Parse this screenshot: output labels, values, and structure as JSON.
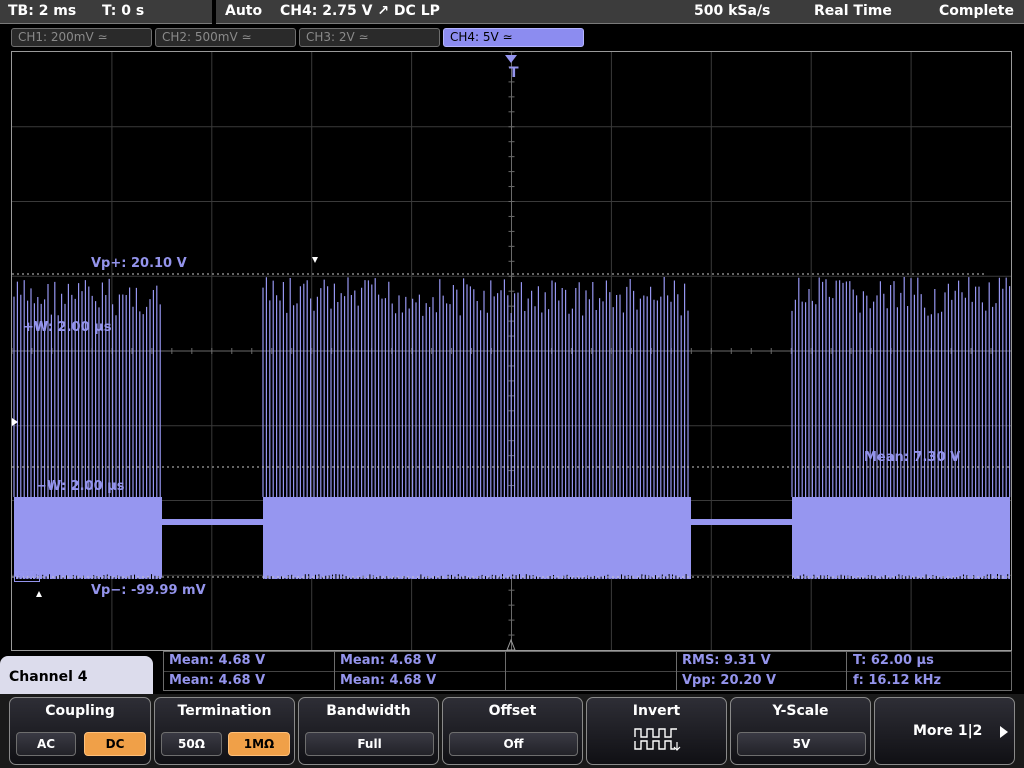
{
  "topbar": {
    "timebase": "TB: 2 ms",
    "trigger_time": "T: 0 s",
    "mode": "Auto",
    "trigger": "CH4: 2.75 V ↗ DC LP",
    "sample_rate": "500 kSa/s",
    "acq_mode": "Real Time",
    "status": "Complete"
  },
  "channel_tabs": [
    {
      "label": "CH1: 200mV ≃",
      "active": false
    },
    {
      "label": "CH2: 500mV ≃",
      "active": false
    },
    {
      "label": "CH3: 2V ≃",
      "active": false
    },
    {
      "label": "CH4: 5V ≃",
      "active": true
    }
  ],
  "screen": {
    "trigger_marker": "T",
    "vp_plus": "Vp+: 20.10 V",
    "vp_minus": "Vp−: -99.99 mV",
    "width_plus": "+W: 2.00 µs",
    "width_minus": "−W: 2.00 µs",
    "mean_label": "Mean: 7.30 V",
    "ch4_ref_label": "CH4",
    "trace_color": "#9696f0"
  },
  "measurements": {
    "row1": [
      "Mean: 4.68 V",
      "Mean: 4.68 V",
      "",
      "RMS: 9.31 V",
      "T: 62.00 µs"
    ],
    "row2": [
      "Mean: 4.68 V",
      "Mean: 4.68 V",
      "",
      "Vpp: 20.20 V",
      "f: 16.12 kHz"
    ]
  },
  "channel_label": "Channel 4",
  "softkeys": {
    "coupling": {
      "title": "Coupling",
      "options": [
        "AC",
        "DC"
      ],
      "selected": "DC"
    },
    "termination": {
      "title": "Termination",
      "options": [
        "50Ω",
        "1MΩ"
      ],
      "selected": "1MΩ"
    },
    "bandwidth": {
      "title": "Bandwidth",
      "value": "Full"
    },
    "offset": {
      "title": "Offset",
      "value": "Off"
    },
    "invert": {
      "title": "Invert",
      "icon": "invert-waveform-icon"
    },
    "yscale": {
      "title": "Y-Scale",
      "value": "5V"
    },
    "more": {
      "label": "More 1|2",
      "icon": "play-arrow-icon"
    }
  },
  "colors": {
    "accent": "#9696f0",
    "selected_option": "#f0a048",
    "tab_active": "#8c8cf0"
  }
}
